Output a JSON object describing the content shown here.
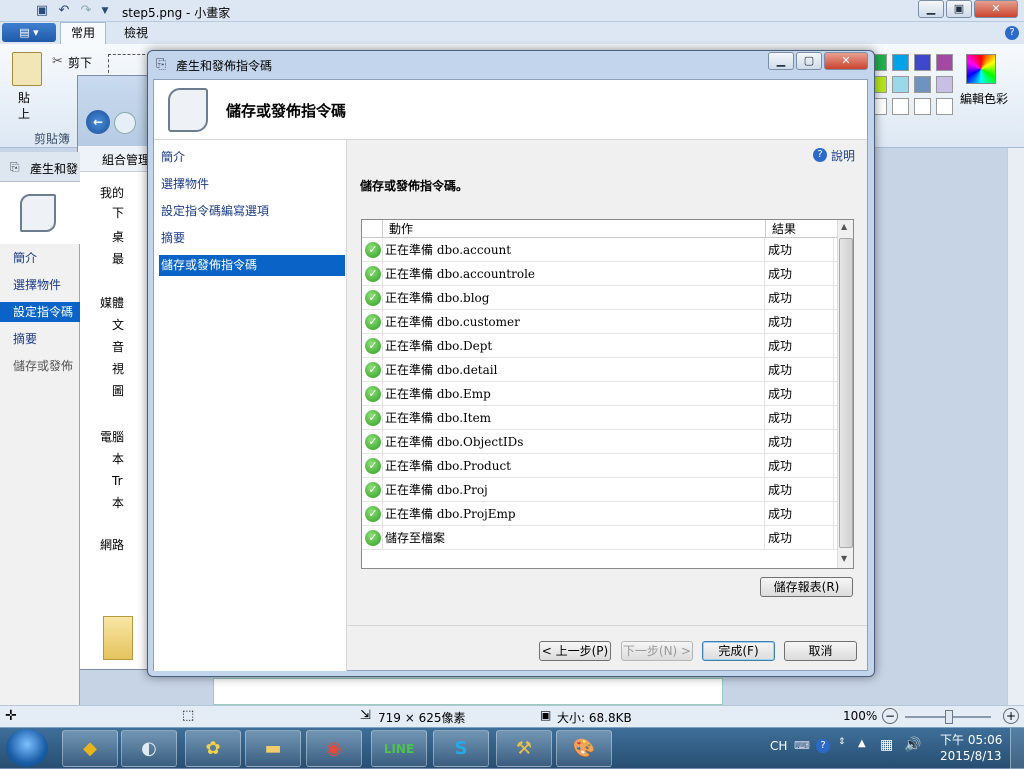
{
  "paint": {
    "title": "step5.png - 小畫家",
    "tabs": [
      "常用",
      "檢視"
    ],
    "paste_label": "貼上",
    "cut_label": "剪下",
    "clipboard_label": "剪貼簿",
    "edit_colors_label": "編輯色彩",
    "status_size": "719 × 625像素",
    "status_filesize": "大小: 68.8KB",
    "zoom": "100%",
    "swatch_colors": [
      "#22b14c",
      "#00a2e8",
      "#3f48cc",
      "#a349a4",
      "#b5e61d",
      "#99d9ea",
      "#7092be",
      "#c8bfe7"
    ]
  },
  "back_wizard": {
    "title": "產生和發",
    "items": [
      "簡介",
      "選擇物件",
      "設定指令碼",
      "摘要",
      "儲存或發佈"
    ]
  },
  "explorer": {
    "organize": "組合管理",
    "items": [
      "我的",
      "下",
      "桌",
      "最",
      "媒體",
      "文",
      "音",
      "視",
      "圖",
      "電腦",
      "本",
      "Tr",
      "本",
      "網路"
    ]
  },
  "dialog": {
    "title": "產生和發佈指令碼",
    "header": "儲存或發佈指令碼",
    "nav": [
      "簡介",
      "選擇物件",
      "設定指令碼編寫選項",
      "摘要",
      "儲存或發佈指令碼"
    ],
    "selected_nav": 4,
    "help_label": "說明",
    "content_title": "儲存或發佈指令碼。",
    "col_action": "動作",
    "col_result": "結果",
    "rows": [
      {
        "action": "正在準備 dbo.account",
        "result": "成功"
      },
      {
        "action": "正在準備 dbo.accountrole",
        "result": "成功"
      },
      {
        "action": "正在準備 dbo.blog",
        "result": "成功"
      },
      {
        "action": "正在準備 dbo.customer",
        "result": "成功"
      },
      {
        "action": "正在準備 dbo.Dept",
        "result": "成功"
      },
      {
        "action": "正在準備 dbo.detail",
        "result": "成功"
      },
      {
        "action": "正在準備 dbo.Emp",
        "result": "成功"
      },
      {
        "action": "正在準備 dbo.Item",
        "result": "成功"
      },
      {
        "action": "正在準備 dbo.ObjectIDs",
        "result": "成功"
      },
      {
        "action": "正在準備 dbo.Product",
        "result": "成功"
      },
      {
        "action": "正在準備 dbo.Proj",
        "result": "成功"
      },
      {
        "action": "正在準備 dbo.ProjEmp",
        "result": "成功"
      },
      {
        "action": "儲存至檔案",
        "result": "成功"
      }
    ],
    "save_report": "儲存報表(R)",
    "prev": "< 上一步(P)",
    "next": "下一步(N) >",
    "finish": "完成(F)",
    "cancel": "取消"
  },
  "taskbar": {
    "lang": "CH",
    "time": "下午 05:06",
    "date": "2015/8/13"
  }
}
